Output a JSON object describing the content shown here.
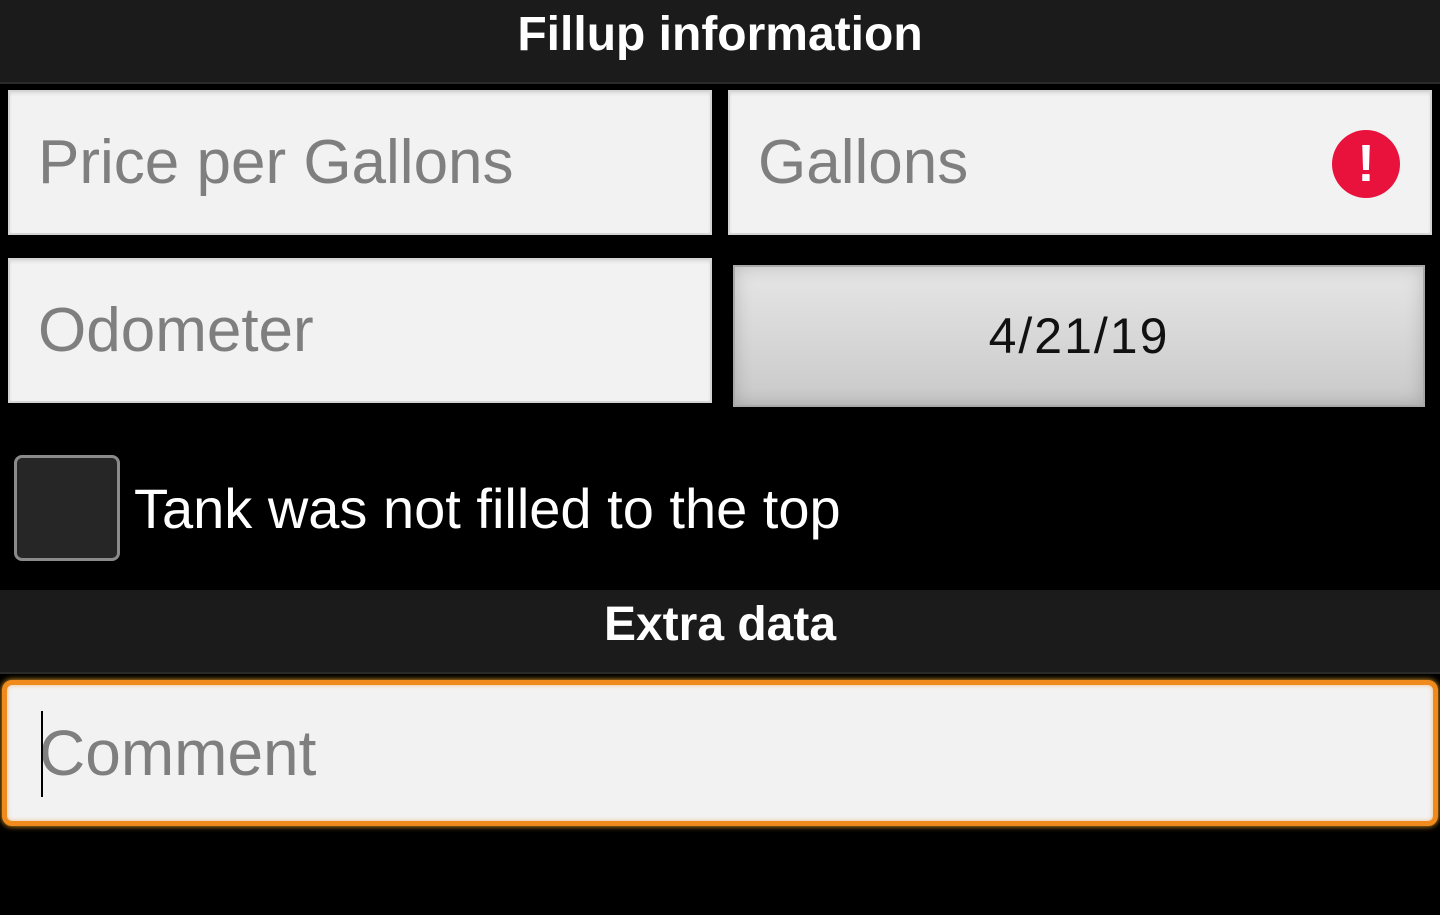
{
  "fillup_section": {
    "title": "Fillup information",
    "price_per_gallons": {
      "placeholder": "Price per Gallons",
      "value": ""
    },
    "gallons": {
      "placeholder": "Gallons",
      "value": "",
      "error_icon": "!"
    },
    "odometer": {
      "placeholder": "Odometer",
      "value": ""
    },
    "date_button": {
      "label": "4/21/19"
    },
    "partial_tank_checkbox": {
      "label": "Tank was not filled to the top",
      "checked": false
    }
  },
  "extra_section": {
    "title": "Extra data",
    "comment": {
      "placeholder": "Comment",
      "value": ""
    }
  },
  "colors": {
    "background": "#000000",
    "header_background": "#1b1b1b",
    "field_background": "#f2f2f2",
    "focus_border": "#f08a1c",
    "error": "#e8123c"
  },
  "icons": {
    "gallons_error": "error-exclamation-icon"
  }
}
